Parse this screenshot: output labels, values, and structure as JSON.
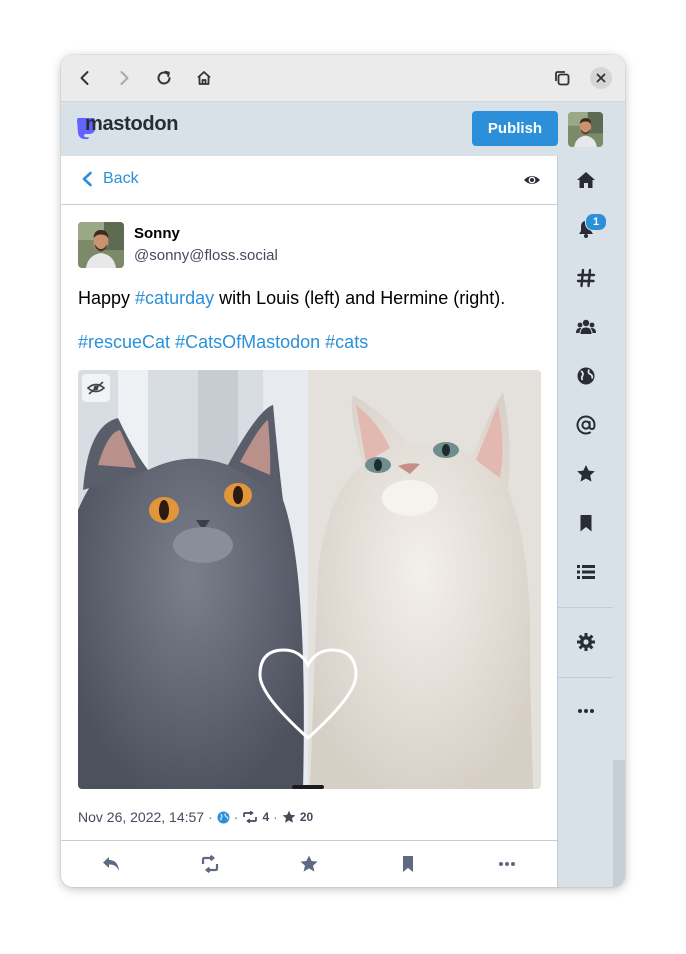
{
  "header": {
    "logo_text": "mastodon",
    "publish_label": "Publish"
  },
  "column": {
    "back_label": "Back"
  },
  "status": {
    "author_name": "Sonny",
    "author_handle": "@sonny@floss.social",
    "text_before": "Happy ",
    "text_hashtag": "#caturday",
    "text_after": " with Louis (left) and Hermine (right).",
    "hashtags": [
      "#rescueCat",
      "#CatsOfMastodon",
      "#cats"
    ],
    "timestamp": "Nov 26, 2022, 14:57",
    "meta_separator": "·",
    "visibility_icon": "globe-icon",
    "reblog_count": "4",
    "favourite_count": "20"
  },
  "notifications": {
    "badge_count": "1"
  },
  "colors": {
    "accent": "#2b90d9",
    "header_bg": "#d9e1e8",
    "text_secondary": "#444b5d",
    "icon": "#282c37"
  },
  "nav_icons": [
    "home-icon",
    "bell-icon",
    "hashtag-icon",
    "users-icon",
    "globe-icon",
    "at-icon",
    "star-icon",
    "bookmark-icon",
    "list-icon",
    "gear-icon",
    "ellipsis-icon"
  ]
}
